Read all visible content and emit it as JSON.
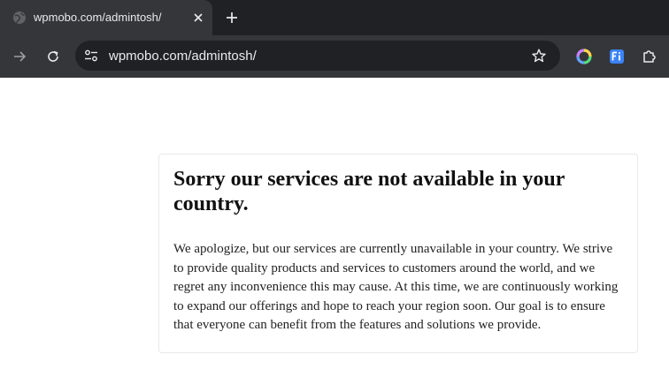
{
  "browser": {
    "tab": {
      "title": "wpmobo.com/admintosh/"
    },
    "omnibox": {
      "url": "wpmobo.com/admintosh/"
    },
    "icons": {
      "favicon": "globe-icon",
      "tab_close": "close-icon",
      "new_tab": "plus-icon",
      "forward": "arrow-right-icon",
      "reload": "reload-icon",
      "site_info": "tune-icon",
      "bookmark": "star-icon",
      "extension_1": "color-wheel-icon",
      "extension_2": "fi-icon",
      "extensions_menu": "puzzle-icon"
    }
  },
  "page": {
    "heading": "Sorry our services are not available in your country.",
    "message": "We apologize, but our services are currently unavailable in your country. We strive to provide quality products and services to customers around the world, and we regret any inconvenience this may cause. At this time, we are continuously working to expand our offerings and hope to reach your region soon. Our goal is to ensure that everyone can benefit from the features and solutions we provide."
  },
  "colors": {
    "tabstrip_bg": "#202124",
    "toolbar_bg": "#35363a",
    "omnibox_bg": "#202124",
    "page_bg": "#ffffff",
    "card_border": "#e9e9e9"
  }
}
